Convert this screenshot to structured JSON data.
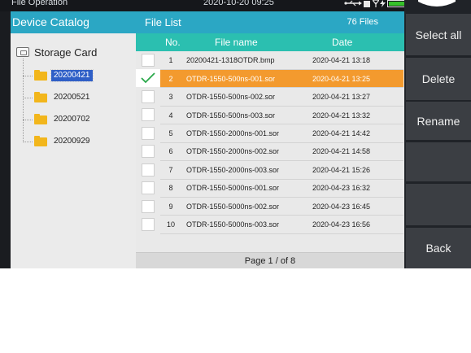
{
  "statusbar": {
    "title": "File Operation",
    "clock": "2020-10-20 09:25",
    "icons": [
      "usb-icon",
      "sd-card-icon",
      "antenna-icon",
      "charging-icon",
      "battery-icon"
    ],
    "battery_color": "#36c12a"
  },
  "catalog": {
    "header": "Device Catalog",
    "root_label": "Storage Card",
    "folders": [
      "20200421",
      "20200521",
      "20200702",
      "20200929"
    ],
    "selected_folder": "20200421"
  },
  "filelist": {
    "header": "File List",
    "count": "76 Files",
    "columns": [
      "No.",
      "File name",
      "Date"
    ],
    "rows": [
      {
        "no": "1",
        "name": "20200421-1318OTDR.bmp",
        "date": "2020-04-21 13:18",
        "checked": false
      },
      {
        "no": "2",
        "name": "OTDR-1550-500ns-001.sor",
        "date": "2020-04-21 13:25",
        "checked": true
      },
      {
        "no": "3",
        "name": "OTDR-1550-500ns-002.sor",
        "date": "2020-04-21 13:27",
        "checked": false
      },
      {
        "no": "4",
        "name": "OTDR-1550-500ns-003.sor",
        "date": "2020-04-21 13:32",
        "checked": false
      },
      {
        "no": "5",
        "name": "OTDR-1550-2000ns-001.sor",
        "date": "2020-04-21 14:42",
        "checked": false
      },
      {
        "no": "6",
        "name": "OTDR-1550-2000ns-002.sor",
        "date": "2020-04-21 14:58",
        "checked": false
      },
      {
        "no": "7",
        "name": "OTDR-1550-2000ns-003.sor",
        "date": "2020-04-21 15:26",
        "checked": false
      },
      {
        "no": "8",
        "name": "OTDR-1550-5000ns-001.sor",
        "date": "2020-04-23 16:32",
        "checked": false
      },
      {
        "no": "9",
        "name": "OTDR-1550-5000ns-002.sor",
        "date": "2020-04-23 16:45",
        "checked": false
      },
      {
        "no": "10",
        "name": "OTDR-1550-5000ns-003.sor",
        "date": "2020-04-23 16:56",
        "checked": false
      }
    ],
    "pager": "Page 1 / of 8"
  },
  "actions": {
    "select_all": "Select all",
    "delete": "Delete",
    "rename": "Rename",
    "back": "Back"
  },
  "colors": {
    "header_blue": "#2ba7c4",
    "column_teal": "#2bbfb0",
    "selected_row": "#f39a2e",
    "selected_folder": "#2f5fc7",
    "check_green": "#2aa84a"
  }
}
